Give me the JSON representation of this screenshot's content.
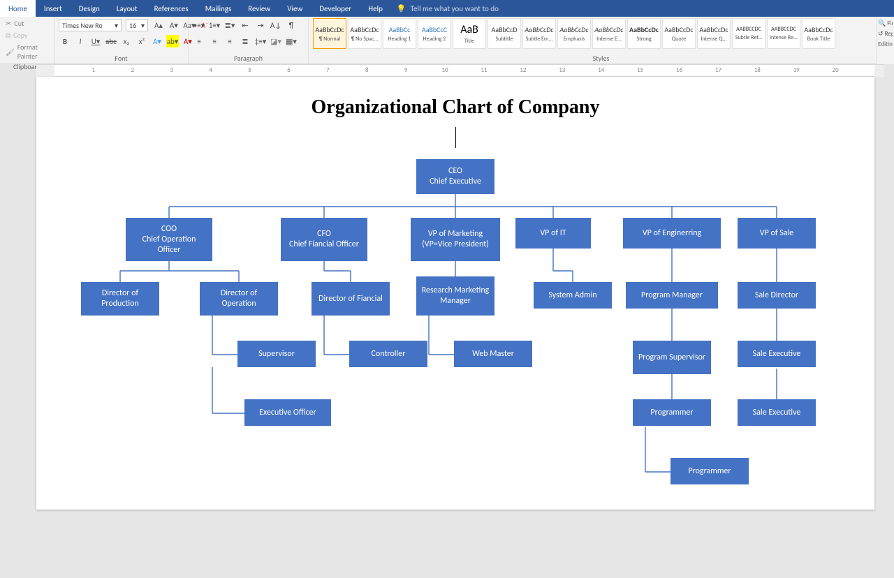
{
  "app": {
    "search_placeholder": "Tell me what you want to do"
  },
  "tabs": [
    "Home",
    "Insert",
    "Design",
    "Layout",
    "References",
    "Mailings",
    "Review",
    "View",
    "Developer",
    "Help"
  ],
  "active_tab": 0,
  "clipboard": {
    "cut": "Cut",
    "copy": "Copy",
    "format_painter": "Format Painter",
    "label": "Clipboard"
  },
  "font": {
    "name": "Times New Ro",
    "size": "16",
    "label": "Font"
  },
  "paragraph": {
    "label": "Paragraph"
  },
  "styles": {
    "label": "Styles",
    "items": [
      {
        "sample": "AaBbCcDc",
        "name": "¶ Normal",
        "sel": true
      },
      {
        "sample": "AaBbCcDc",
        "name": "¶ No Spac..."
      },
      {
        "sample": "AaBbCc",
        "name": "Heading 1"
      },
      {
        "sample": "AaBbCcC",
        "name": "Heading 2"
      },
      {
        "sample": "AaB",
        "name": "Title"
      },
      {
        "sample": "AaBbCcD",
        "name": "Subtitle"
      },
      {
        "sample": "AaBbCcDc",
        "name": "Subtle Em..."
      },
      {
        "sample": "AaBbCcDc",
        "name": "Emphasis"
      },
      {
        "sample": "AaBbCcDc",
        "name": "Intense E..."
      },
      {
        "sample": "AaBbCcDc",
        "name": "Strong"
      },
      {
        "sample": "AaBbCcDc",
        "name": "Quote"
      },
      {
        "sample": "AaBbCcDc",
        "name": "Intense Q..."
      },
      {
        "sample": "AABBCCDC",
        "name": "Subtle Ref..."
      },
      {
        "sample": "AABBCCDC",
        "name": "Intense Re..."
      },
      {
        "sample": "AaBbCcDc",
        "name": "Book Title"
      }
    ]
  },
  "editing": {
    "find": "Find",
    "replace": "Replace",
    "label": "Editing"
  },
  "doc": {
    "title": "Organizational Chart of Company"
  },
  "chart_data": {
    "type": "org-hierarchy",
    "root": "CEO\nChief Executive",
    "children": [
      {
        "label": "COO\nChief Operation Officer",
        "children": [
          {
            "label": "Director of Production"
          },
          {
            "label": "Director of Operation",
            "children": [
              {
                "label": "Supervisor",
                "children": [
                  {
                    "label": "Executive Officer"
                  }
                ]
              }
            ]
          }
        ]
      },
      {
        "label": "CFO\nChief Fiancial Officer",
        "children": [
          {
            "label": "Director of Fiancial",
            "children": [
              {
                "label": "Controller"
              }
            ]
          }
        ]
      },
      {
        "label": "VP of Marketing\n(VP=Vice President)",
        "children": [
          {
            "label": "Research Marketing Manager",
            "children": [
              {
                "label": "Web Master"
              }
            ]
          }
        ]
      },
      {
        "label": "VP of IT",
        "children": [
          {
            "label": "System Admin"
          }
        ]
      },
      {
        "label": "VP of Enginerring",
        "children": [
          {
            "label": "Program Manager",
            "children": [
              {
                "label": "Program Supervisor",
                "children": [
                  {
                    "label": "Programmer",
                    "children": [
                      {
                        "label": "Programmer"
                      }
                    ]
                  }
                ]
              }
            ]
          }
        ]
      },
      {
        "label": "VP of Sale",
        "children": [
          {
            "label": "Sale Director",
            "children": [
              {
                "label": "Sale Executive",
                "children": [
                  {
                    "label": "Sale Executive"
                  }
                ]
              }
            ]
          }
        ]
      }
    ]
  },
  "nodes": {
    "ceo": "CEO\nChief Executive",
    "coo": "COO\nChief Operation Officer",
    "cfo": "CFO\nChief Fiancial Officer",
    "vpm": "VP of Marketing\n(VP=Vice President)",
    "vpi": "VP of IT",
    "vpe": "VP of Enginerring",
    "vps": "VP of Sale",
    "dprod": "Director of Production",
    "dop": "Director of Operation",
    "dfin": "Director of Fiancial",
    "rmm": "Research Marketing Manager",
    "sysa": "System Admin",
    "pm": "Program Manager",
    "saled": "Sale Director",
    "sup": "Supervisor",
    "ctrl": "Controller",
    "web": "Web Master",
    "psup": "Program Supervisor",
    "se1": "Sale Executive",
    "exo": "Executive Officer",
    "prog1": "Programmer",
    "se2": "Sale Executive",
    "prog2": "Programmer"
  },
  "ruler_numbers": [
    1,
    2,
    3,
    4,
    5,
    6,
    7,
    8,
    9,
    10,
    11,
    12,
    13,
    14,
    15,
    16,
    17,
    18,
    19,
    20
  ]
}
